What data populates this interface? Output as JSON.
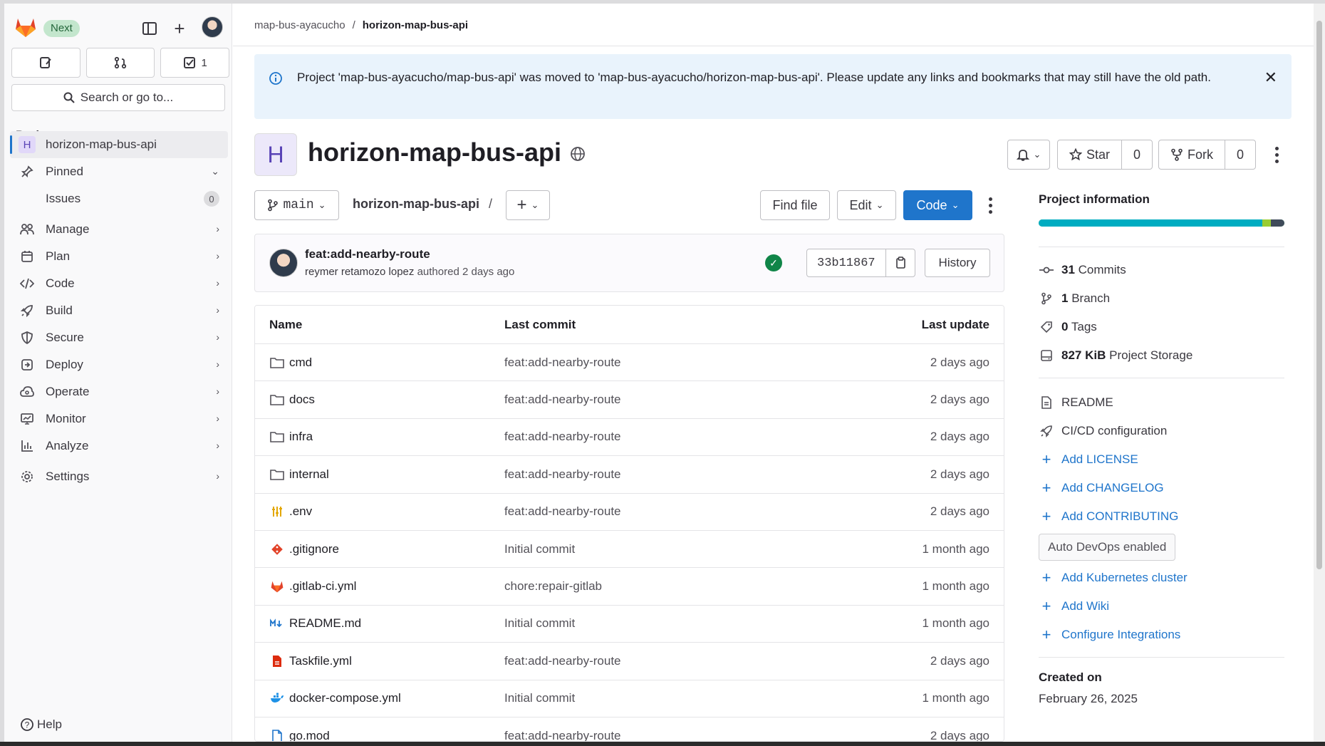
{
  "sidebar": {
    "badge": "Next",
    "counter_issues": "1",
    "search_placeholder": "Search or go to...",
    "section_title": "Project",
    "project_name": "horizon-map-bus-api",
    "project_letter": "H",
    "pinned": "Pinned",
    "issues_label": "Issues",
    "issues_count": "0",
    "nav": [
      "Manage",
      "Plan",
      "Code",
      "Build",
      "Secure",
      "Deploy",
      "Operate",
      "Monitor",
      "Analyze",
      "Settings"
    ],
    "help": "Help"
  },
  "breadcrumb": {
    "group": "map-bus-ayacucho",
    "separator": "/",
    "project": "horizon-map-bus-api"
  },
  "alert": {
    "message": "Project 'map-bus-ayacucho/map-bus-api' was moved to 'map-bus-ayacucho/horizon-map-bus-api'. Please update any links and bookmarks that may still have the old path."
  },
  "project": {
    "letter": "H",
    "title": "horizon-map-bus-api",
    "star_label": "Star",
    "star_count": "0",
    "fork_label": "Fork",
    "fork_count": "0"
  },
  "toolbar": {
    "branch": "main",
    "path": "horizon-map-bus-api",
    "path_sep": "/",
    "find_file": "Find file",
    "edit": "Edit",
    "code": "Code"
  },
  "commit": {
    "title": "feat:add-nearby-route",
    "author": "reymer retamozo lopez",
    "meta": "authored 2 days ago",
    "sha": "33b11867",
    "history": "History"
  },
  "table": {
    "headers": {
      "name": "Name",
      "last_commit": "Last commit",
      "last_update": "Last update"
    },
    "rows": [
      {
        "name": "cmd",
        "icon": "folder-icon",
        "commit": "feat:add-nearby-route",
        "updated": "2 days ago"
      },
      {
        "name": "docs",
        "icon": "folder-icon",
        "commit": "feat:add-nearby-route",
        "updated": "2 days ago"
      },
      {
        "name": "infra",
        "icon": "folder-icon",
        "commit": "feat:add-nearby-route",
        "updated": "2 days ago"
      },
      {
        "name": "internal",
        "icon": "folder-icon",
        "commit": "feat:add-nearby-route",
        "updated": "2 days ago"
      },
      {
        "name": ".env",
        "icon": "env-file-icon",
        "commit": "feat:add-nearby-route",
        "updated": "2 days ago"
      },
      {
        "name": ".gitignore",
        "icon": "git-file-icon",
        "commit": "Initial commit",
        "updated": "1 month ago"
      },
      {
        "name": ".gitlab-ci.yml",
        "icon": "gitlab-file-icon",
        "commit": "chore:repair-gitlab",
        "updated": "1 month ago"
      },
      {
        "name": "README.md",
        "icon": "markdown-file-icon",
        "commit": "Initial commit",
        "updated": "1 month ago"
      },
      {
        "name": "Taskfile.yml",
        "icon": "yaml-file-icon",
        "commit": "feat:add-nearby-route",
        "updated": "2 days ago"
      },
      {
        "name": "docker-compose.yml",
        "icon": "docker-file-icon",
        "commit": "Initial commit",
        "updated": "1 month ago"
      },
      {
        "name": "go.mod",
        "icon": "file-icon",
        "commit": "feat:add-nearby-route",
        "updated": "2 days ago"
      }
    ]
  },
  "info": {
    "title": "Project information",
    "commits_count": "31",
    "commits_label": "Commits",
    "branch_count": "1",
    "branch_label": "Branch",
    "tags_count": "0",
    "tags_label": "Tags",
    "storage_size": "827 KiB",
    "storage_label": "Project Storage",
    "readme": "README",
    "cicd": "CI/CD configuration",
    "add_license": "Add LICENSE",
    "add_changelog": "Add CHANGELOG",
    "add_contributing": "Add CONTRIBUTING",
    "auto_devops": "Auto DevOps enabled",
    "add_k8s": "Add Kubernetes cluster",
    "add_wiki": "Add Wiki",
    "configure_integrations": "Configure Integrations",
    "created_label": "Created on",
    "created_date": "February 26, 2025"
  },
  "colors": {
    "accent": "#1f75cb",
    "success": "#108548",
    "storage_repo": "#00acc1",
    "storage_other": "#9acd32",
    "storage_rest": "#404b5a"
  }
}
